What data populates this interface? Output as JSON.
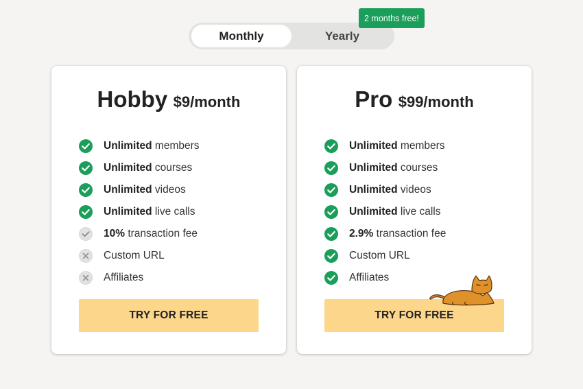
{
  "toggle": {
    "monthly_label": "Monthly",
    "yearly_label": "Yearly",
    "selected": "Monthly",
    "badge": "2 months free!"
  },
  "plans": [
    {
      "name": "Hobby",
      "price": "$9/month",
      "cta": "TRY FOR FREE",
      "features": [
        {
          "bold": "Unlimited",
          "text": " members",
          "status": "included",
          "icon": "check-circle-green"
        },
        {
          "bold": "Unlimited",
          "text": " courses",
          "status": "included",
          "icon": "check-circle-green"
        },
        {
          "bold": "Unlimited",
          "text": " videos",
          "status": "included",
          "icon": "check-circle-green"
        },
        {
          "bold": "Unlimited",
          "text": " live calls",
          "status": "included",
          "icon": "check-circle-green"
        },
        {
          "bold": "10%",
          "text": " transaction fee",
          "status": "partial",
          "icon": "check-circle-gray"
        },
        {
          "bold": "",
          "text": "Custom URL",
          "status": "excluded",
          "icon": "x-circle-gray"
        },
        {
          "bold": "",
          "text": "Affiliates",
          "status": "excluded",
          "icon": "x-circle-gray"
        }
      ]
    },
    {
      "name": "Pro",
      "price": "$99/month",
      "cta": "TRY FOR FREE",
      "features": [
        {
          "bold": "Unlimited",
          "text": " members",
          "status": "included",
          "icon": "check-circle-green"
        },
        {
          "bold": "Unlimited",
          "text": " courses",
          "status": "included",
          "icon": "check-circle-green"
        },
        {
          "bold": "Unlimited",
          "text": " videos",
          "status": "included",
          "icon": "check-circle-green"
        },
        {
          "bold": "Unlimited",
          "text": " live calls",
          "status": "included",
          "icon": "check-circle-green"
        },
        {
          "bold": "2.9%",
          "text": " transaction fee",
          "status": "included",
          "icon": "check-circle-green"
        },
        {
          "bold": "",
          "text": "Custom URL",
          "status": "included",
          "icon": "check-circle-green"
        },
        {
          "bold": "",
          "text": "Affiliates",
          "status": "included",
          "icon": "check-circle-green"
        }
      ]
    }
  ],
  "decoration": {
    "icon": "cat-illustration"
  },
  "colors": {
    "accent_green": "#1a9e5a",
    "cta_yellow": "#fcd68b",
    "background": "#f5f4f2",
    "cat_orange": "#e0922a"
  }
}
